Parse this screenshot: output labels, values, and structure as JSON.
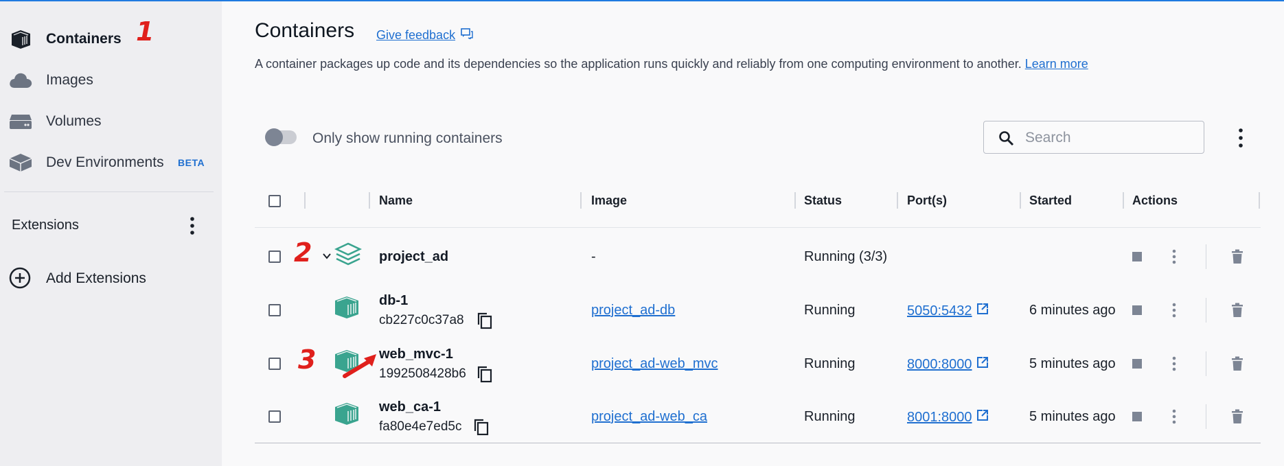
{
  "sidebar": {
    "items": [
      {
        "label": "Containers",
        "icon": "containers-icon",
        "active": true
      },
      {
        "label": "Images",
        "icon": "cloud-icon"
      },
      {
        "label": "Volumes",
        "icon": "volume-icon"
      },
      {
        "label": "Dev Environments",
        "icon": "dev-env-icon",
        "badge": "BETA"
      }
    ],
    "extensions_label": "Extensions",
    "add_extensions_label": "Add Extensions"
  },
  "annotations": [
    "1",
    "2",
    "3"
  ],
  "header": {
    "title": "Containers",
    "feedback_link": "Give feedback",
    "description": "A container packages up code and its dependencies so the application runs quickly and reliably from one computing environment to another.",
    "learn_more": "Learn more"
  },
  "toolbar": {
    "toggle_label": "Only show running containers",
    "toggle_on": false,
    "search_placeholder": "Search"
  },
  "table": {
    "columns": [
      "Name",
      "Image",
      "Status",
      "Port(s)",
      "Started",
      "Actions"
    ],
    "rows": [
      {
        "name": "project_ad",
        "id": "",
        "image": "-",
        "status": "Running (3/3)",
        "port": "",
        "started": "",
        "type": "group"
      },
      {
        "name": "db-1",
        "id": "cb227c0c37a8",
        "image": "project_ad-db",
        "status": "Running",
        "port": "5050:5432",
        "started": "6 minutes ago",
        "type": "container"
      },
      {
        "name": "web_mvc-1",
        "id": "1992508428b6",
        "image": "project_ad-web_mvc",
        "status": "Running",
        "port": "8000:8000",
        "started": "5 minutes ago",
        "type": "container"
      },
      {
        "name": "web_ca-1",
        "id": "fa80e4e7ed5c",
        "image": "project_ad-web_ca",
        "status": "Running",
        "port": "8001:8000",
        "started": "5 minutes ago",
        "type": "container"
      }
    ]
  },
  "colors": {
    "accent": "#1f6fd0",
    "container_icon": "#3aa48f",
    "annotation": "#e0201c"
  }
}
